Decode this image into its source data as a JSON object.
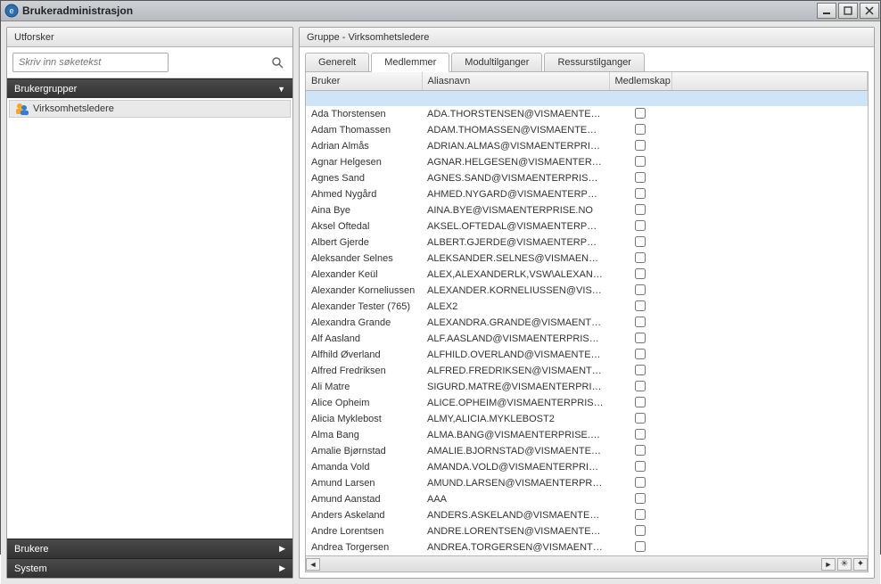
{
  "window": {
    "title": "Brukeradministrasjon"
  },
  "explorer": {
    "title": "Utforsker",
    "search_placeholder": "Skriv inn søketekst",
    "sections": {
      "brukergrupper": {
        "label": "Brukergrupper",
        "item": "Virksomhetsledere"
      },
      "brukere": {
        "label": "Brukere"
      },
      "system": {
        "label": "System"
      }
    }
  },
  "detail": {
    "title": "Gruppe - Virksomhetsledere",
    "tabs": {
      "generelt": "Generelt",
      "medlemmer": "Medlemmer",
      "modultilganger": "Modultilganger",
      "ressurstilganger": "Ressurstilganger"
    },
    "columns": {
      "bruker": "Bruker",
      "aliasnavn": "Aliasnavn",
      "medlemskap": "Medlemskap"
    },
    "rows": [
      {
        "bruker": "Ada Thorstensen",
        "alias": "ADA.THORSTENSEN@VISMAENTERPRISE.I"
      },
      {
        "bruker": "Adam Thomassen",
        "alias": "ADAM.THOMASSEN@VISMAENTERPRISE.N"
      },
      {
        "bruker": "Adrian Almås",
        "alias": "ADRIAN.ALMAS@VISMAENTERPRISE.NO"
      },
      {
        "bruker": "Agnar Helgesen",
        "alias": "AGNAR.HELGESEN@VISMAENTERPRISE.N"
      },
      {
        "bruker": "Agnes Sand",
        "alias": "AGNES.SAND@VISMAENTERPRISE.NO"
      },
      {
        "bruker": "Ahmed Nygård",
        "alias": "AHMED.NYGARD@VISMAENTERPRISE.NO"
      },
      {
        "bruker": "Aina Bye",
        "alias": "AINA.BYE@VISMAENTERPRISE.NO"
      },
      {
        "bruker": "Aksel Oftedal",
        "alias": "AKSEL.OFTEDAL@VISMAENTERPRISE.NO"
      },
      {
        "bruker": "Albert Gjerde",
        "alias": "ALBERT.GJERDE@VISMAENTERPRISE.NO"
      },
      {
        "bruker": "Aleksander Selnes",
        "alias": "ALEKSANDER.SELNES@VISMAENTERPRISE"
      },
      {
        "bruker": "Alexander Keül",
        "alias": "ALEX,ALEXANDERLK,VSW\\ALEXANDERLK"
      },
      {
        "bruker": "Alexander Korneliussen",
        "alias": "ALEXANDER.KORNELIUSSEN@VISMAENTE"
      },
      {
        "bruker": "Alexander Tester (765)",
        "alias": "ALEX2"
      },
      {
        "bruker": "Alexandra Grande",
        "alias": "ALEXANDRA.GRANDE@VISMAENTERPRISE"
      },
      {
        "bruker": "Alf Aasland",
        "alias": "ALF.AASLAND@VISMAENTERPRISE.NO"
      },
      {
        "bruker": "Alfhild Øverland",
        "alias": "ALFHILD.OVERLAND@VISMAENTERPRISE."
      },
      {
        "bruker": "Alfred Fredriksen",
        "alias": "ALFRED.FREDRIKSEN@VISMAENTERPRISE"
      },
      {
        "bruker": "Ali Matre",
        "alias": "SIGURD.MATRE@VISMAENTERPRISE.NO"
      },
      {
        "bruker": "Alice Opheim",
        "alias": "ALICE.OPHEIM@VISMAENTERPRISE.NO"
      },
      {
        "bruker": "Alicia Myklebost",
        "alias": "ALMY,ALICIA.MYKLEBOST2"
      },
      {
        "bruker": "Alma Bang",
        "alias": "ALMA.BANG@VISMAENTERPRISE.NO"
      },
      {
        "bruker": "Amalie Bjørnstad",
        "alias": "AMALIE.BJORNSTAD@VISMAENTERPRISE."
      },
      {
        "bruker": "Amanda Vold",
        "alias": "AMANDA.VOLD@VISMAENTERPRISE.NO"
      },
      {
        "bruker": "Amund Larsen",
        "alias": "AMUND.LARSEN@VISMAENTERPRISE.NO,"
      },
      {
        "bruker": "Amund Aanstad",
        "alias": "AAA"
      },
      {
        "bruker": "Anders Askeland",
        "alias": "ANDERS.ASKELAND@VISMAENTERPRISE.N"
      },
      {
        "bruker": "Andre Lorentsen",
        "alias": "ANDRE.LORENTSEN@VISMAENTERPRISE.I"
      },
      {
        "bruker": "Andrea Torgersen",
        "alias": "ANDREA.TORGERSEN@VISMAENTERPRISE"
      }
    ]
  }
}
